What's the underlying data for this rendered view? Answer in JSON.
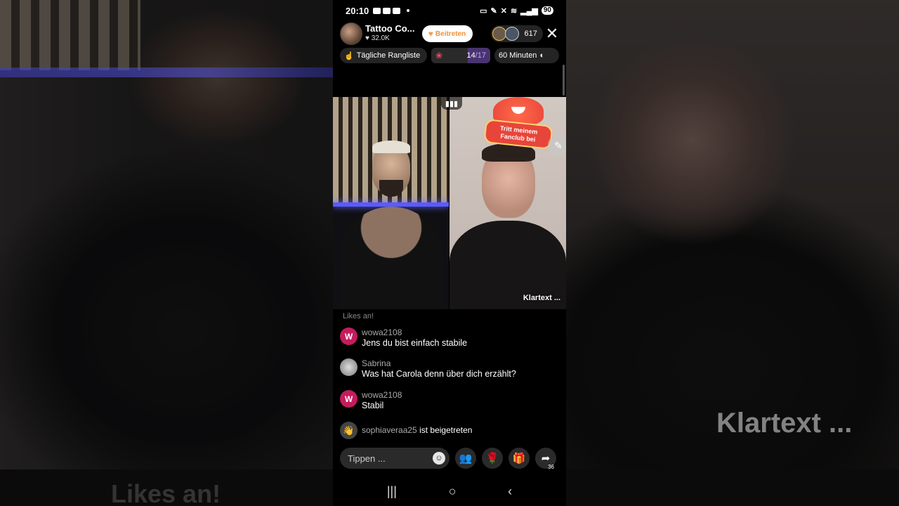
{
  "status_bar": {
    "time": "20:10",
    "battery": "90"
  },
  "header": {
    "host_name": "Tattoo Co...",
    "host_likes": "32.0K",
    "join_label": "Beitreten",
    "viewer_count": "617"
  },
  "ticker": {
    "ranking_label": "Tägliche Rangliste",
    "goal_progress": "14",
    "goal_total": "/17",
    "timer_label": "60 Minuten"
  },
  "videos": {
    "fanclub_badge": "Tritt meinem Fanclub bei",
    "guest_name": "Klartext ..."
  },
  "chat": {
    "faded_text": "Likes an!",
    "messages": [
      {
        "initial": "W",
        "user": "wowa2108",
        "text": "Jens du bist einfach stabile"
      },
      {
        "initial": "",
        "user": "Sabrina",
        "text": "Was hat Carola denn über dich erzählt?"
      },
      {
        "initial": "W",
        "user": "wowa2108",
        "text": "Stabil"
      }
    ],
    "join_user": "sophiaveraa25",
    "join_text": "ist beigetreten"
  },
  "action_bar": {
    "comment_placeholder": "Tippen ...",
    "share_count": "36"
  },
  "background": {
    "right_label": "Klartext ...",
    "left_label": "Likes an!"
  },
  "colors": {
    "join_accent": "#f0913a",
    "chat_avatar": "#c21d5c",
    "fanclub_red": "#e8453a",
    "neon_blue": "#5b5bff"
  }
}
